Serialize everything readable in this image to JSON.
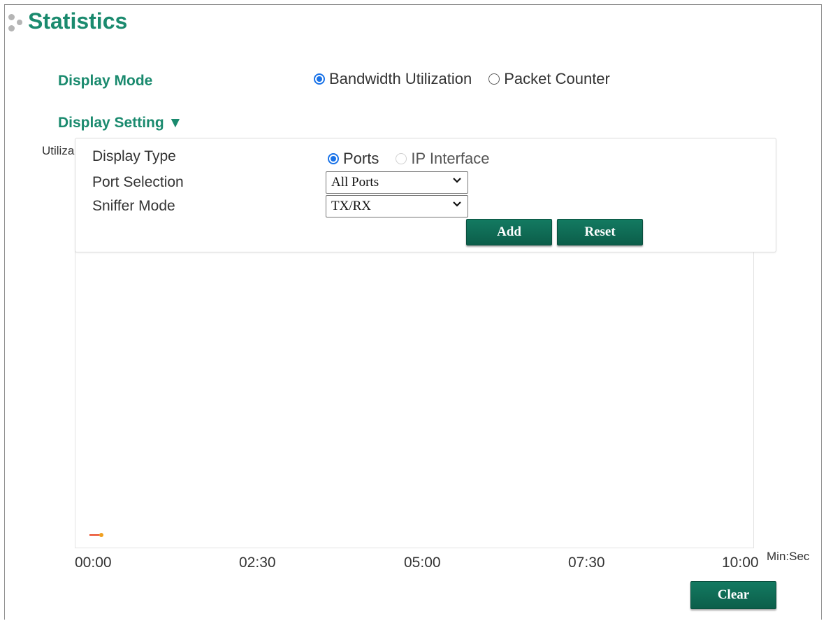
{
  "header": {
    "title": "Statistics"
  },
  "display_mode": {
    "label": "Display Mode",
    "options": [
      {
        "label": "Bandwidth Utilization",
        "checked": true
      },
      {
        "label": "Packet Counter",
        "checked": false
      }
    ]
  },
  "display_setting": {
    "label": "Display Setting ▼",
    "display_type": {
      "label": "Display Type",
      "options": [
        {
          "label": "Ports",
          "checked": true
        },
        {
          "label": "IP Interface",
          "checked": false,
          "disabled": true
        }
      ]
    },
    "port_selection": {
      "label": "Port Selection",
      "value": "All Ports"
    },
    "sniffer_mode": {
      "label": "Sniffer Mode",
      "value": "TX/RX"
    },
    "add_label": "Add",
    "reset_label": "Reset"
  },
  "chart_data": {
    "type": "line",
    "ylabel": "Utiliza",
    "x_unit": "Min:Sec",
    "x_ticks": [
      "00:00",
      "02:30",
      "05:00",
      "07:30",
      "10:00"
    ],
    "series": [
      {
        "color": "#e8421e",
        "point_color": "#f0a020",
        "points": [
          {
            "x": "00:00",
            "y": 0
          }
        ]
      }
    ]
  },
  "footer": {
    "clear_label": "Clear"
  },
  "colors": {
    "accent": "#1a8a6e",
    "button": "#0f6b55",
    "radio_checked": "#1a73e8"
  }
}
